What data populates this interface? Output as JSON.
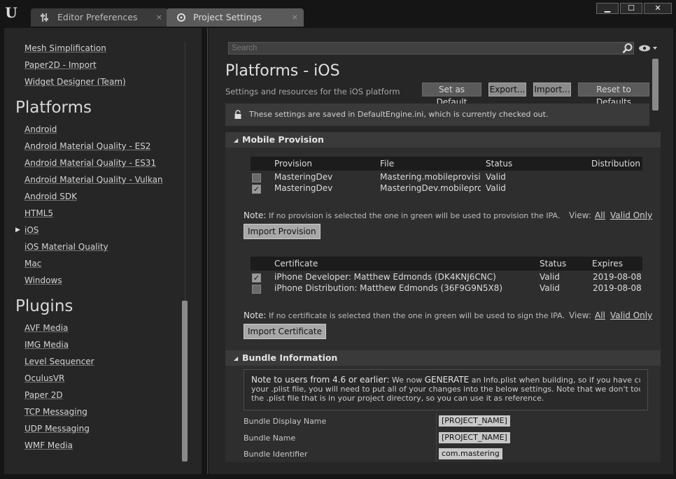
{
  "window": {
    "logo": "U",
    "tabs": [
      {
        "label": "Editor Preferences",
        "close": "×"
      },
      {
        "label": "Project Settings",
        "close": "×"
      }
    ],
    "buttons": {
      "minimize": "▁",
      "maximize": "☐",
      "close": "✕"
    }
  },
  "sidebar": {
    "top_items": [
      "Mesh Simplification",
      "Paper2D - Import",
      "Widget Designer (Team)"
    ],
    "platforms_title": "Platforms",
    "platforms": [
      "Android",
      "Android Material Quality - ES2",
      "Android Material Quality - ES31",
      "Android Material Quality - Vulkan",
      "Android SDK",
      "HTML5",
      "iOS",
      "iOS Material Quality",
      "Mac",
      "Windows"
    ],
    "selected_arrow": "▶",
    "plugins_title": "Plugins",
    "plugins": [
      "AVF Media",
      "IMG Media",
      "Level Sequencer",
      "OculusVR",
      "Paper 2D",
      "TCP Messaging",
      "UDP Messaging",
      "WMF Media"
    ]
  },
  "search": {
    "placeholder": "Search"
  },
  "page": {
    "title": "Platforms - iOS",
    "subtitle": "Settings and resources for the iOS platform",
    "buttons": {
      "set_default": "Set as Default",
      "export": "Export...",
      "import": "Import...",
      "reset": "Reset to Defaults"
    },
    "notice": "These settings are saved in DefaultEngine.ini, which is currently checked out."
  },
  "mobile_provision": {
    "header": "Mobile Provision",
    "arrow": "◢",
    "provision_table": {
      "columns": [
        "Provision",
        "File",
        "Status",
        "Distribution"
      ],
      "rows": [
        {
          "checked": "",
          "provision": "MasteringDev",
          "file": "Mastering.mobileprovision",
          "status": "Valid"
        },
        {
          "checked": "✓",
          "provision": "MasteringDev",
          "file": "MasteringDev.mobileprovision",
          "status": "Valid"
        }
      ]
    },
    "provision_note_label": "Note:",
    "provision_note": "If no provision is selected the one in green will be used to provision the IPA.",
    "view_label": "View:",
    "view_all": "All",
    "view_valid": "Valid Only",
    "import_provision": "Import Provision",
    "cert_table": {
      "columns": [
        "Certificate",
        "Status",
        "Expires"
      ],
      "rows": [
        {
          "checked": "✓",
          "certificate": "iPhone Developer: Matthew Edmonds (DK4KNJ6CNC)",
          "status": "Valid",
          "expires": "2019-08-08"
        },
        {
          "checked": "",
          "certificate": "iPhone Distribution: Matthew Edmonds (36F9G9N5X8)",
          "status": "Valid",
          "expires": "2019-08-08"
        }
      ]
    },
    "cert_note_label": "Note:",
    "cert_note": "If no certificate is selected then the one in green will be used to sign the IPA.",
    "import_certificate": "Import Certificate"
  },
  "bundle": {
    "header": "Bundle Information",
    "note_lead": "Note to users from 4.6 or earlier:",
    "note_mid": " We now ",
    "note_generate": "GENERATE",
    "note_rest1": " an Info.plist when building, so if you have customized",
    "note_line2": "your .plist file, you will need to put all of your changes into the below settings. Note that we don't touch",
    "note_line3": "the .plist file that is in your project directory, so you can use it as reference.",
    "props": [
      {
        "label": "Bundle Display Name",
        "value": "[PROJECT_NAME]"
      },
      {
        "label": "Bundle Name",
        "value": "[PROJECT_NAME]"
      },
      {
        "label": "Bundle Identifier",
        "value": "com.mastering"
      }
    ]
  },
  "colors": {
    "panel": "#262626",
    "category": "#3a3a3a",
    "accent_text": "#e0e0e0"
  }
}
